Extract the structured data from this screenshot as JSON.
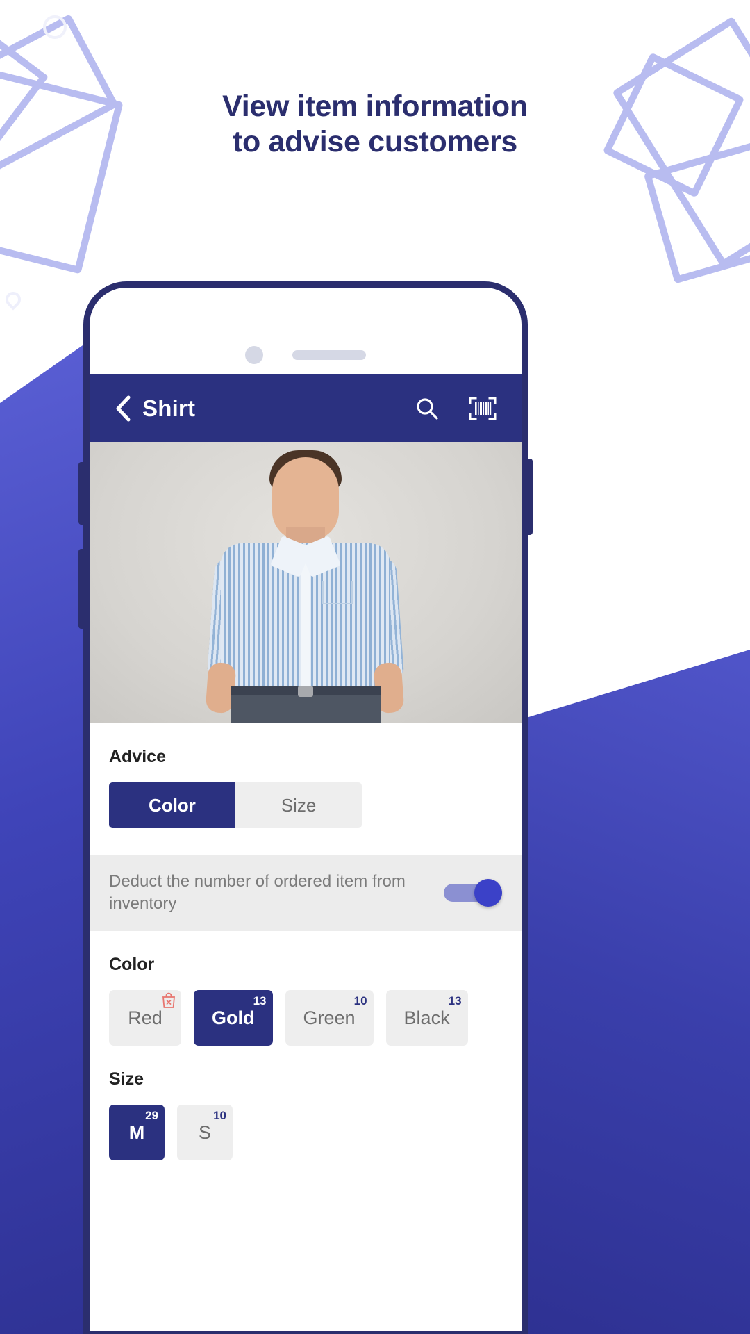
{
  "headline": {
    "line1": "View item information",
    "line2": "to advise customers",
    "color": "#2b2e6e"
  },
  "theme": {
    "primary": "#2b3180",
    "accent": "#3b41c8",
    "chip_off_bg": "#eeeeee",
    "muted_text": "#6d6d6d",
    "outline_decor": "#b8bcf0"
  },
  "phone": {
    "notch": {
      "camera": "camera-dot",
      "speaker": "speaker-grille"
    }
  },
  "appbar": {
    "back_icon": "chevron-left-icon",
    "title": "Shirt",
    "search_icon": "search-icon",
    "barcode_icon": "barcode-scan-icon"
  },
  "product_image": {
    "alt": "man wearing blue striped shirt"
  },
  "advice": {
    "label": "Advice",
    "tabs": [
      {
        "label": "Color",
        "active": true
      },
      {
        "label": "Size",
        "active": false
      }
    ]
  },
  "deduct_setting": {
    "text": "Deduct the number of ordered item from inventory",
    "toggle_on": true
  },
  "color_section": {
    "label": "Color",
    "options": [
      {
        "label": "Red",
        "badge": "",
        "selected": false,
        "out_of_stock": true,
        "icon": "bag-out-of-stock-icon"
      },
      {
        "label": "Gold",
        "badge": "13",
        "selected": true,
        "out_of_stock": false
      },
      {
        "label": "Green",
        "badge": "10",
        "selected": false,
        "out_of_stock": false
      },
      {
        "label": "Black",
        "badge": "13",
        "selected": false,
        "out_of_stock": false
      }
    ]
  },
  "size_section": {
    "label": "Size",
    "options": [
      {
        "label": "M",
        "badge": "29",
        "selected": true
      },
      {
        "label": "S",
        "badge": "10",
        "selected": false
      }
    ]
  }
}
